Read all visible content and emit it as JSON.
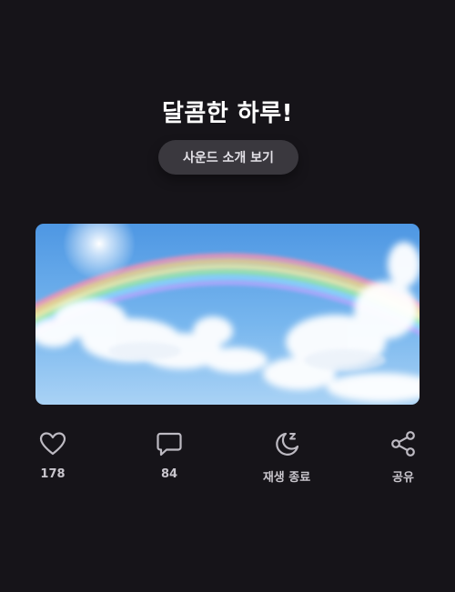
{
  "title": "달콤한 하루!",
  "sound_intro_button": "사운드 소개 보기",
  "actions": {
    "like": {
      "icon": "heart-icon",
      "label": "178"
    },
    "comment": {
      "icon": "comment-icon",
      "label": "84"
    },
    "sleep_timer": {
      "icon": "moon-sleep-icon",
      "label": "재생 종료"
    },
    "share": {
      "icon": "share-icon",
      "label": "공유"
    }
  },
  "colors": {
    "background": "#161419",
    "button_bg": "#3a383e",
    "icon": "#bdbac2",
    "title": "#ffffff"
  }
}
